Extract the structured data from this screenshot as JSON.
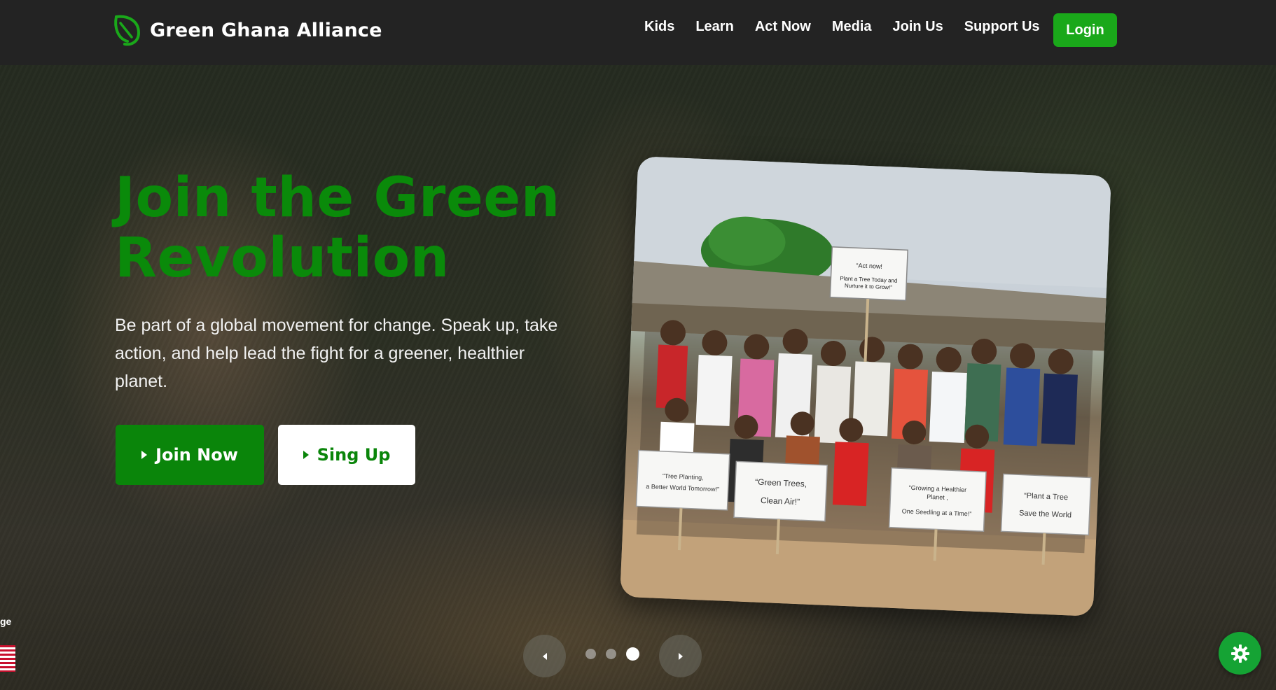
{
  "header": {
    "brand_name": "Green Ghana Alliance",
    "brand_icon": "leaf-logo-icon",
    "nav": [
      {
        "label": "Kids"
      },
      {
        "label": "Learn"
      },
      {
        "label": "Act Now"
      },
      {
        "label": "Media"
      },
      {
        "label": "Join Us"
      },
      {
        "label": "Support Us"
      }
    ],
    "login_label": "Login"
  },
  "hero": {
    "title_line1": "Join the Green",
    "title_line2": "Revolution",
    "subtitle": "Be part of a global movement for change. Speak up, take action, and help lead the fight for a greener, healthier planet.",
    "primary_button": "Join Now",
    "secondary_button": "Sing Up"
  },
  "photo": {
    "signs": [
      {
        "text": "“Act now!"
      },
      {
        "text": "Plant a Tree Today and"
      },
      {
        "text": "Nurture it to Grow!”"
      },
      {
        "text": "“Tree Planting,"
      },
      {
        "text": "a Better World Tomorrow!”"
      },
      {
        "text": "“Green Trees,"
      },
      {
        "text": "Clean Air!”"
      },
      {
        "text": "“Growing a Healthier"
      },
      {
        "text": "Planet ,"
      },
      {
        "text": "One Seedling at a Time!”"
      },
      {
        "text": "“Plant a Tree"
      },
      {
        "text": "Save the World"
      }
    ]
  },
  "slider": {
    "slide_count": 3,
    "active_index": 2
  },
  "language": {
    "label_fragment": "ge",
    "flag_icon": "us-flag-icon"
  },
  "settings": {
    "icon": "gear-icon"
  },
  "colors": {
    "header_bg": "#232323",
    "accent_green": "#0a850a",
    "login_green": "#1aa81a",
    "fab_green": "#15a334"
  }
}
